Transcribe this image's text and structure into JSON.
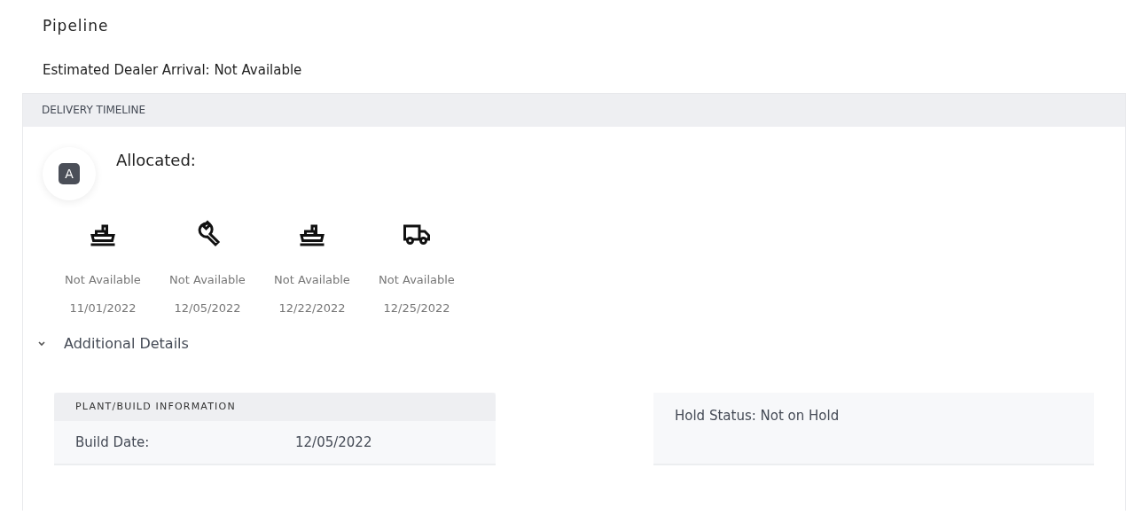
{
  "title": "Pipeline",
  "estimated_arrival": "Estimated Dealer Arrival: Not Available",
  "timeline": {
    "header": "DELIVERY TIMELINE",
    "badge": "A",
    "status": "Allocated:",
    "steps": [
      {
        "kind": "ship",
        "label": "Not Available",
        "date": "11/01/2022"
      },
      {
        "kind": "wrench",
        "label": "Not Available",
        "date": "12/05/2022"
      },
      {
        "kind": "ship",
        "label": "Not Available",
        "date": "12/22/2022"
      },
      {
        "kind": "truck",
        "label": "Not Available",
        "date": "12/25/2022"
      }
    ]
  },
  "additional_details": {
    "label": "Additional Details",
    "expanded": true,
    "plant_build": {
      "header": "PLANT/BUILD INFORMATION",
      "rows": [
        {
          "label": "Build Date:",
          "value": "12/05/2022"
        }
      ]
    },
    "hold_status": "Hold Status: Not on Hold"
  }
}
